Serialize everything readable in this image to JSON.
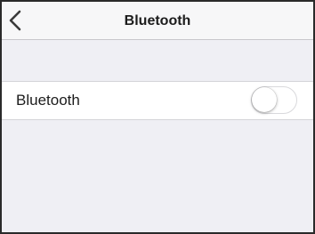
{
  "nav": {
    "title": "Bluetooth",
    "back_icon": "chevron-left-icon"
  },
  "settings": {
    "bluetooth_row": {
      "label": "Bluetooth",
      "toggle_on": false
    }
  },
  "colors": {
    "background": "#efeff4",
    "nav_background": "#f7f7f8",
    "row_background": "#ffffff",
    "text": "#1c1c1c",
    "toggle_off_border": "#d9d9dc"
  }
}
